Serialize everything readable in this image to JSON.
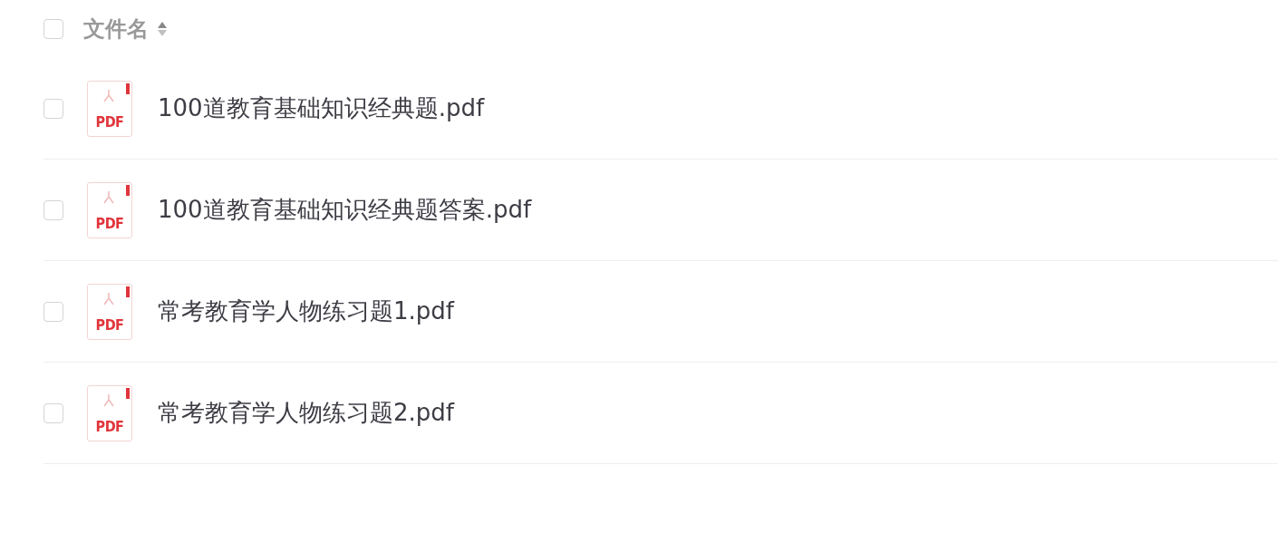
{
  "header": {
    "checked": false,
    "label": "文件名"
  },
  "files": [
    {
      "checked": false,
      "icon_label": "PDF",
      "name": "100道教育基础知识经典题.pdf"
    },
    {
      "checked": false,
      "icon_label": "PDF",
      "name": "100道教育基础知识经典题答案.pdf"
    },
    {
      "checked": false,
      "icon_label": "PDF",
      "name": "常考教育学人物练习题1.pdf"
    },
    {
      "checked": false,
      "icon_label": "PDF",
      "name": "常考教育学人物练习题2.pdf"
    }
  ]
}
